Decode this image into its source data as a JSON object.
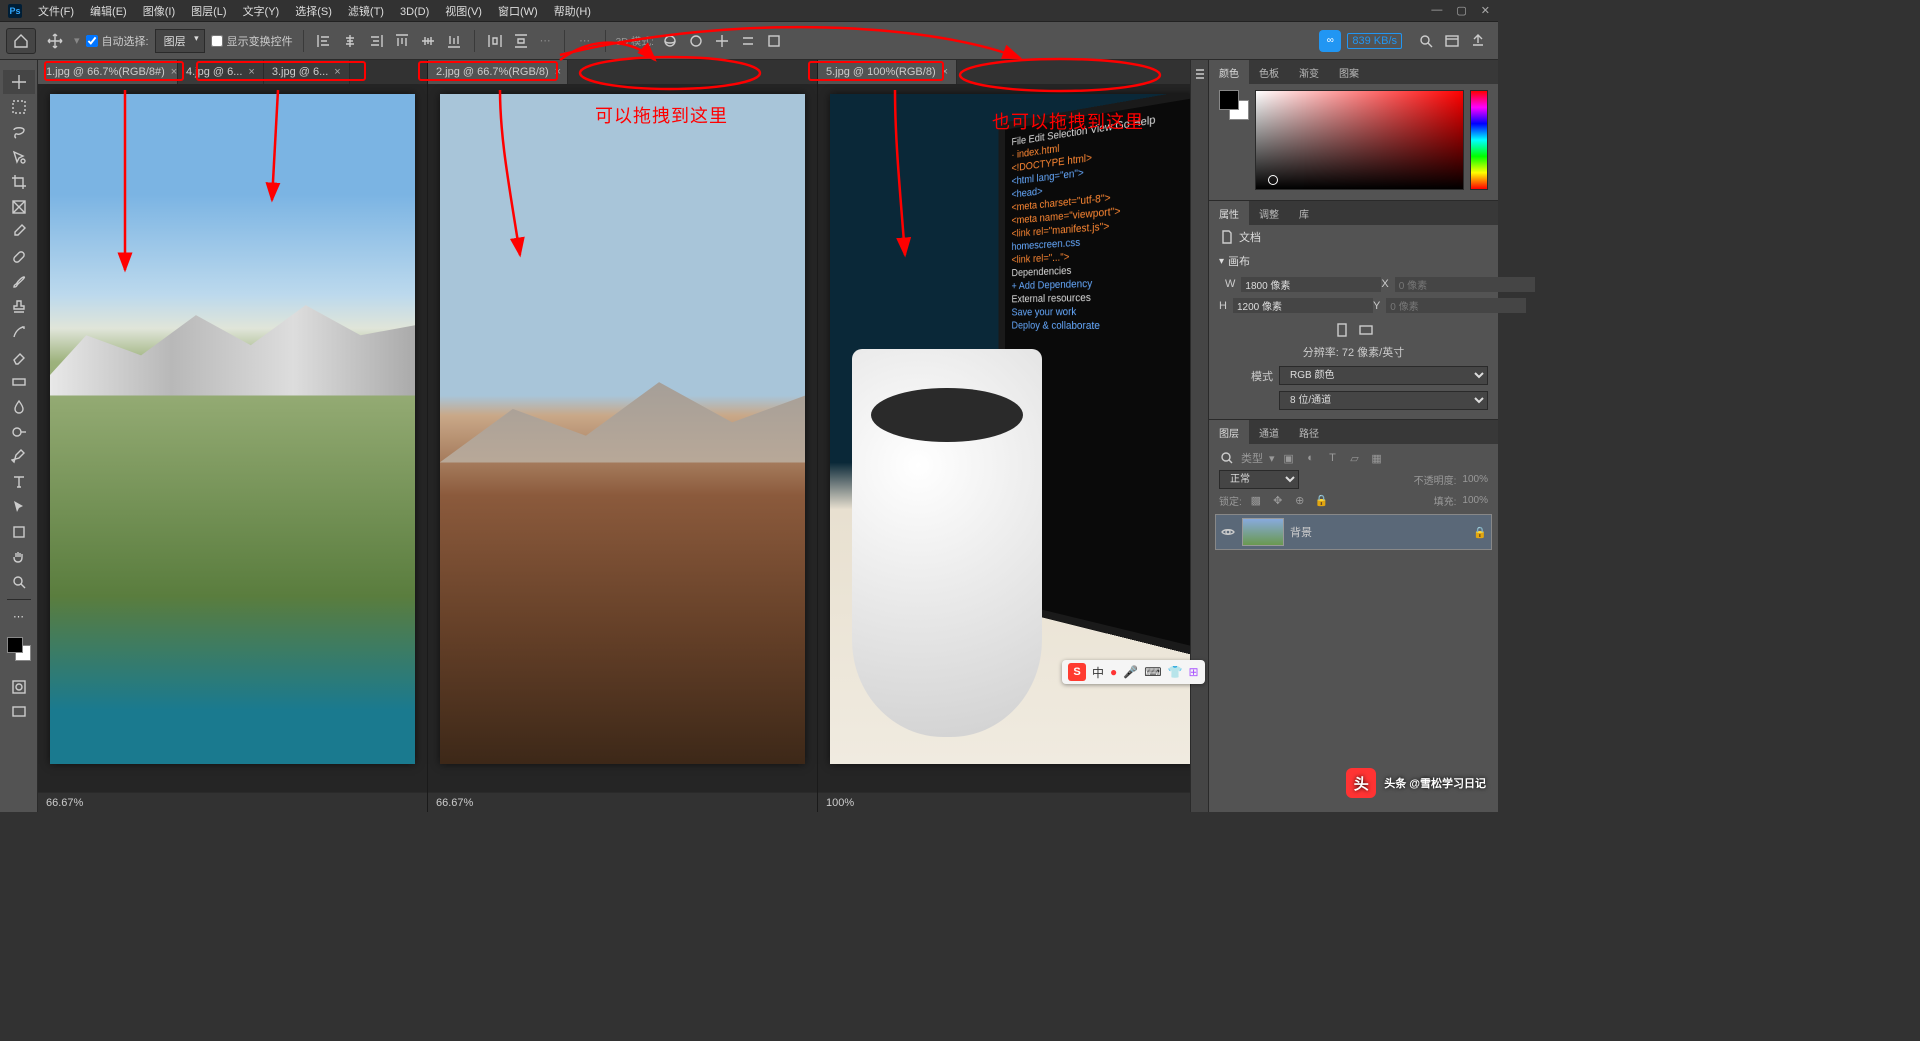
{
  "app": {
    "logo": "Ps"
  },
  "menu": [
    "文件(F)",
    "编辑(E)",
    "图像(I)",
    "图层(L)",
    "文字(Y)",
    "选择(S)",
    "滤镜(T)",
    "3D(D)",
    "视图(V)",
    "窗口(W)",
    "帮助(H)"
  ],
  "options": {
    "auto_select": "自动选择:",
    "auto_select_checked": true,
    "layer_mode": "图层",
    "show_transform": "显示变换控件",
    "show_transform_checked": false,
    "mode3d": "3D 模式:",
    "cloud_speed": "839 KB/s"
  },
  "tabs_group1": [
    {
      "label": "1.jpg @ 66.7%(RGB/8#)",
      "active": true
    },
    {
      "label": "4.jpg @ 6...",
      "active": false
    },
    {
      "label": "3.jpg @ 6...",
      "active": false
    }
  ],
  "tabs_group2": [
    {
      "label": "2.jpg @ 66.7%(RGB/8)",
      "active": true
    }
  ],
  "tabs_group3": [
    {
      "label": "5.jpg @ 100%(RGB/8)",
      "active": true
    }
  ],
  "zoom": {
    "g1": "66.67%",
    "g2": "66.67%",
    "g3": "100%"
  },
  "annotations": {
    "drag_here": "可以拖拽到这里",
    "also_drag_here": "也可以拖拽到这里"
  },
  "panels": {
    "color_tabs": [
      "颜色",
      "色板",
      "渐变",
      "图案"
    ],
    "prop_tabs": [
      "属性",
      "调整",
      "库"
    ],
    "layer_tabs": [
      "图层",
      "通道",
      "路径"
    ],
    "doc_label": "文档",
    "canvas_label": "画布",
    "w_label": "W",
    "w_val": "1800 像素",
    "x_label": "X",
    "x_val": "0 像素",
    "h_label": "H",
    "h_val": "1200 像素",
    "y_label": "Y",
    "y_val": "0 像素",
    "resolution": "分辨率: 72 像素/英寸",
    "mode_label": "模式",
    "mode_val": "RGB 颜色",
    "depth_val": "8 位/通道",
    "filter_label": "类型",
    "blend_mode": "正常",
    "opacity_label": "不透明度:",
    "opacity_val": "100%",
    "lock_label": "锁定:",
    "fill_label": "填充:",
    "fill_val": "100%",
    "bg_layer": "背景"
  },
  "ime": {
    "cn": "中"
  },
  "watermark": "头条 @雪松学习日记"
}
